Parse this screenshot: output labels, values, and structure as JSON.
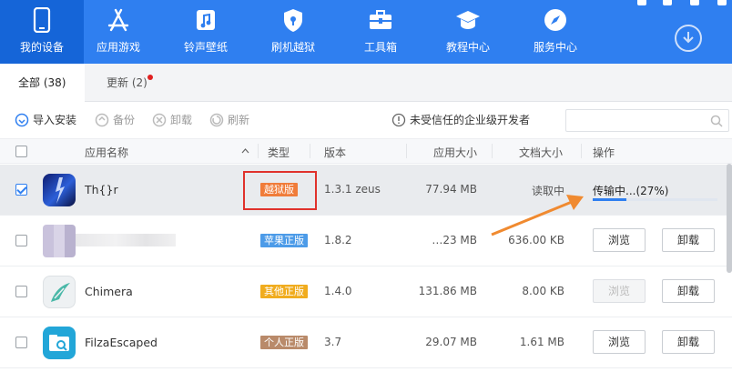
{
  "nav": {
    "items": [
      {
        "label": "我的设备",
        "icon": "phone-icon"
      },
      {
        "label": "应用游戏",
        "icon": "app-store-icon"
      },
      {
        "label": "铃声壁纸",
        "icon": "music-icon"
      },
      {
        "label": "刷机越狱",
        "icon": "shield-icon"
      },
      {
        "label": "工具箱",
        "icon": "toolbox-icon"
      },
      {
        "label": "教程中心",
        "icon": "graduation-cap-icon"
      },
      {
        "label": "服务中心",
        "icon": "compass-icon"
      }
    ],
    "active_index": 0
  },
  "tabs": [
    {
      "label": "全部 (38)"
    },
    {
      "label": "更新 (2)"
    }
  ],
  "toolbar": {
    "import": "导入安装",
    "backup": "备份",
    "uninstall": "卸载",
    "refresh": "刷新",
    "warning": "未受信任的企业级开发者",
    "search_placeholder": ""
  },
  "columns": {
    "name": "应用名称",
    "type": "类型",
    "version": "版本",
    "app_size": "应用大小",
    "doc_size": "文档大小",
    "action": "操作"
  },
  "rows": [
    {
      "name": "Th{}r",
      "badge": "越狱版",
      "badge_color": "#f07c3a",
      "version": "1.3.1 zeus",
      "app_size": "77.94 MB",
      "doc_size": "读取中",
      "status": "传输中...(27%)",
      "progress": 0.27,
      "checked": true
    },
    {
      "name": "",
      "badge": "苹果正版",
      "badge_color": "#4c9be8",
      "version": "1.8.2",
      "app_size": "…23 MB",
      "doc_size": "636.00 KB",
      "browse": "浏览",
      "uninstall": "卸载",
      "checked": false
    },
    {
      "name": "Chimera",
      "badge": "其他正版",
      "badge_color": "#f0ac1e",
      "version": "1.4.0",
      "app_size": "131.86 MB",
      "doc_size": "8.00 KB",
      "browse": "浏览",
      "uninstall": "卸载",
      "checked": false
    },
    {
      "name": "FilzaEscaped",
      "badge": "个人正版",
      "badge_color": "#b98a6a",
      "version": "3.7",
      "app_size": "29.07 MB",
      "doc_size": "1.61 MB",
      "browse": "浏览",
      "uninstall": "卸载",
      "checked": false
    }
  ],
  "colors": {
    "accent": "#2f7ff0",
    "highlight": "#e0322c",
    "arrow": "#f08a30"
  }
}
